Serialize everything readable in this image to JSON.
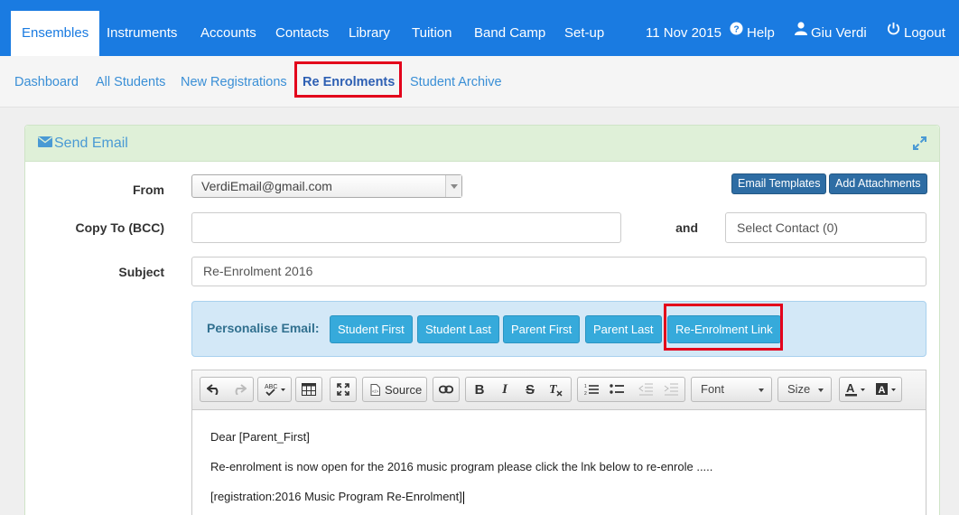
{
  "topnav": {
    "items": [
      "Ensembles",
      "Instruments",
      "Accounts",
      "Contacts",
      "Library",
      "Tuition",
      "Band Camp",
      "Set-up"
    ],
    "date": "11 Nov 2015",
    "help": "Help",
    "user": "Giu Verdi",
    "logout": "Logout"
  },
  "subnav": {
    "items": [
      "Dashboard",
      "All Students",
      "New Registrations",
      "Re Enrolments",
      "Student Archive"
    ]
  },
  "panel": {
    "title": "Send Email"
  },
  "form": {
    "from_label": "From",
    "from_value": "VerdiEmail@gmail.com",
    "bcc_label": "Copy To (BCC)",
    "bcc_value": "",
    "and_label": "and",
    "select_contact": "Select Contact (0)",
    "subject_label": "Subject",
    "subject_value": "Re-Enrolment 2016",
    "email_templates": "Email Templates",
    "add_attachments": "Add Attachments"
  },
  "personalise": {
    "label": "Personalise Email:",
    "buttons": [
      "Student First",
      "Student Last",
      "Parent First",
      "Parent Last",
      "Re-Enrolment Link"
    ]
  },
  "editor": {
    "source_label": "Source",
    "font_label": "Font",
    "size_label": "Size",
    "lines": [
      "Dear [Parent_First]",
      "Re-enrolment is now open for the 2016 music program please click the lnk below to re-enrole .....",
      "[registration:2016 Music Program Re-Enrolment]"
    ]
  },
  "colors": {
    "brand": "#1a7be1",
    "panel_header": "#dff0d8",
    "highlight": "#e3001b",
    "personalise_button": "#36aadb"
  }
}
